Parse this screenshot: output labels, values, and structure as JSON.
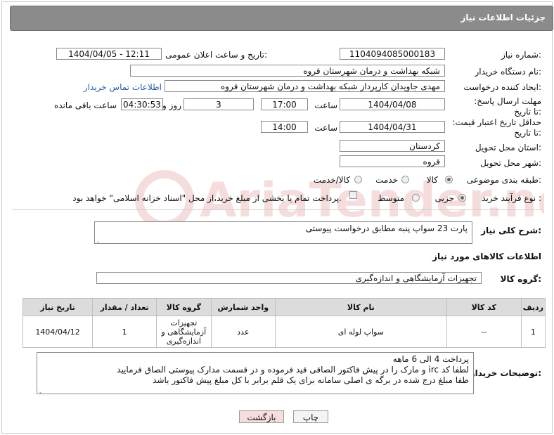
{
  "header": {
    "title": "جزئیات اطلاعات نیاز"
  },
  "form": {
    "need_number_label": "شماره نیاز:",
    "need_number": "1104094085000183",
    "announce_label": "تاریخ و ساعت اعلان عمومی:",
    "announce_value": "1404/04/05 - 12:11",
    "buyer_org_label": "نام دستگاه خریدار:",
    "buyer_org": "شبکه بهداشت و درمان شهرستان قروه",
    "requester_label": "ایجاد کننده درخواست:",
    "requester": "مهدی جاویدان کارپرداز شبکه بهداشت و درمان شهرستان قروه",
    "contact_link": "اطلاعات تماس خریدار",
    "deadline_label": "مهلت ارسال پاسخ: تا تاریخ:",
    "deadline_date": "1404/04/08",
    "time_label": "ساعت",
    "deadline_time": "17:00",
    "days_value": "3",
    "days_label": "روز و",
    "remaining_time": "04:30:53",
    "remaining_label": "ساعت باقی مانده",
    "validity_label": "حداقل تاریخ اعتبار قیمت: تا تاریخ:",
    "validity_date": "1404/04/31",
    "validity_time": "14:00",
    "province_label": "استان محل تحویل:",
    "province": "کردستان",
    "city_label": "شهر محل تحویل:",
    "city": "قروه",
    "category_label": "طبقه بندی موضوعی:",
    "category_options": [
      "کالا",
      "خدمت",
      "کالا/خدمت"
    ],
    "category_selected": "کالا",
    "process_label": "نوع فرآیند خرید :",
    "process_options": [
      "جزیی",
      "متوسط"
    ],
    "process_selected": "جزیی",
    "payment_note": "پرداخت تمام یا بخشی از مبلغ خرید،از محل \"اسناد خزانه اسلامی\" خواهد بود."
  },
  "summary": {
    "label": "شرح کلی نیاز:",
    "text": "پارت 23 سواپ پنبه مطابق درخواست پیوستی"
  },
  "goods": {
    "section_title": "اطلاعات کالاهای مورد نیاز",
    "group_label": "گروه کالا:",
    "group_value": "تجهیزات آزمایشگاهی و اندازه‌گیری",
    "columns": [
      "ردیف",
      "کد کالا",
      "نام کالا",
      "واحد شمارش",
      "گروه کالا",
      "تعداد / مقدار",
      "تاریخ نیاز"
    ],
    "rows": [
      {
        "row": "1",
        "code": "--",
        "name": "سواپ لوله ای",
        "unit": "عدد",
        "group": "تجهیزات آزمایشگاهی و اندازه‌گیری",
        "qty": "1",
        "date": "1404/04/12"
      }
    ]
  },
  "buyer_notes": {
    "label": "توضیحات خریدار:",
    "lines": [
      "پرداخت 4 الی 6 ماهه",
      "لطفا کد irc  و مارک را در پیش فاکتور الصاقی قید فرموده و در قسمت مدارک پیوستی الصاق فرمایید",
      "طفا مبلغ درج شده در برگه ی اصلی سامانه برای یک قلم برابر با کل مبلغ پیش فاکتور باشد"
    ]
  },
  "buttons": {
    "print": "چاپ",
    "back": "بازگشت"
  },
  "watermark": {
    "text": "AriaTender.neT"
  },
  "colors": {
    "header_bg": "#8b8b8b",
    "link": "#2a5db0",
    "back_button_bg": "#f7dede"
  }
}
